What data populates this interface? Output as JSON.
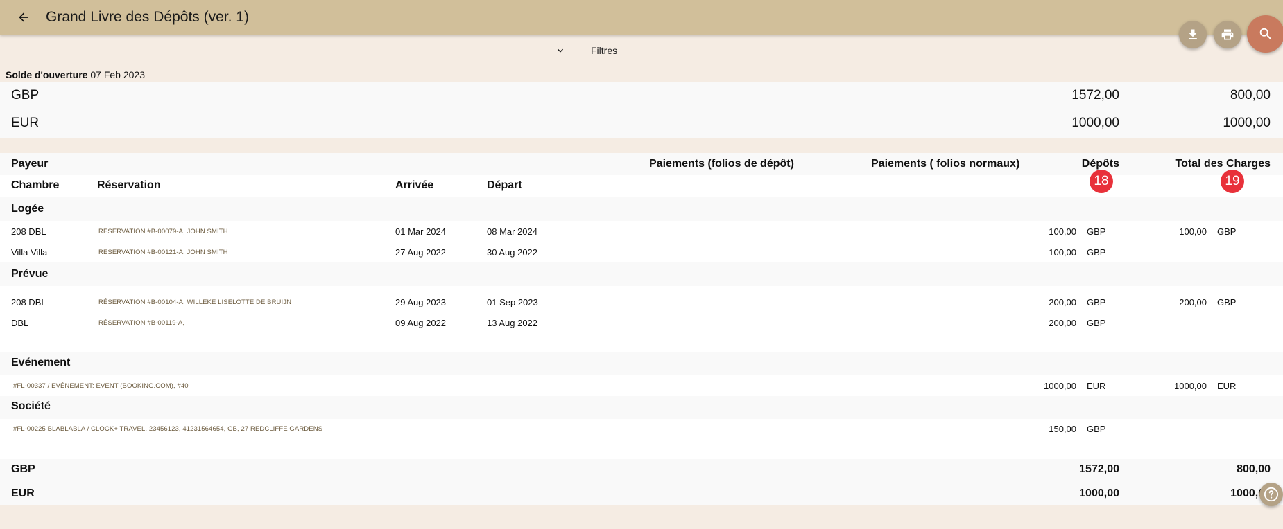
{
  "header": {
    "title": "Grand Livre des Dépôts (ver. 1)"
  },
  "icons": {
    "back": "arrow-left-icon",
    "download": "download-icon",
    "print": "print-icon",
    "search": "search-icon",
    "filters_toggle": "chevron-down-icon",
    "help": "help-icon"
  },
  "filters": {
    "label": "Filtres"
  },
  "opening": {
    "label": "Solde d'ouverture",
    "date": "07 Feb 2023"
  },
  "opening_balances": [
    {
      "currency": "GBP",
      "deposits": "1572,00",
      "charges": "800,00"
    },
    {
      "currency": "EUR",
      "deposits": "1000,00",
      "charges": "1000,00"
    }
  ],
  "columns": {
    "payer": "Payeur",
    "deposit_folio_payments": "Paiements (folios de dépôt)",
    "normal_folio_payments": "Paiements ( folios normaux)",
    "deposits": "Dépôts",
    "total_charges": "Total des Charges",
    "room": "Chambre",
    "reservation": "Réservation",
    "arrival": "Arrivée",
    "departure": "Départ",
    "deposits_badge": "18",
    "charges_badge": "19"
  },
  "sections": {
    "logee": {
      "title": "Logée",
      "rows": [
        {
          "room": "208 DBL",
          "reservation": "RÉSERVATION #B-00079-A, JOHN SMITH",
          "arrival": "01 Mar 2024",
          "departure": "08 Mar 2024",
          "deposit": "100,00",
          "deposit_cur": "GBP",
          "charge": "100,00",
          "charge_cur": "GBP"
        },
        {
          "room": "Villa Villa",
          "reservation": "RÉSERVATION #B-00121-A, JOHN SMITH",
          "arrival": "27 Aug 2022",
          "departure": "30 Aug 2022",
          "deposit": "100,00",
          "deposit_cur": "GBP",
          "charge": "",
          "charge_cur": ""
        }
      ]
    },
    "prevue": {
      "title": "Prévue",
      "rows": [
        {
          "room": "208 DBL",
          "reservation": "RÉSERVATION #B-00104-A, WILLEKE LISELOTTE DE BRUIJN",
          "arrival": "29 Aug 2023",
          "departure": "01 Sep 2023",
          "deposit": "200,00",
          "deposit_cur": "GBP",
          "charge": "200,00",
          "charge_cur": "GBP"
        },
        {
          "room": "DBL",
          "reservation": "RÉSERVATION #B-00119-A,",
          "arrival": "09 Aug 2022",
          "departure": "13 Aug 2022",
          "deposit": "200,00",
          "deposit_cur": "GBP",
          "charge": "",
          "charge_cur": ""
        }
      ]
    },
    "evenement": {
      "title": "Evénement",
      "rows": [
        {
          "folio": "#FL-00337 / EVÉNEMENT: EVENT (BOOKING.COM), #40",
          "deposit": "1000,00",
          "deposit_cur": "EUR",
          "charge": "1000,00",
          "charge_cur": "EUR"
        }
      ]
    },
    "societe": {
      "title": "Société",
      "rows": [
        {
          "folio": "#FL-00225 BLABLABLA / CLOCK+ TRAVEL, 23456123, 41231564654, GB, 27 REDCLIFFE GARDENS",
          "deposit": "150,00",
          "deposit_cur": "GBP",
          "charge": "",
          "charge_cur": ""
        }
      ]
    }
  },
  "totals": [
    {
      "currency": "GBP",
      "deposits": "1572,00",
      "charges": "800,00"
    },
    {
      "currency": "EUR",
      "deposits": "1000,00",
      "charges": "1000,00"
    }
  ]
}
